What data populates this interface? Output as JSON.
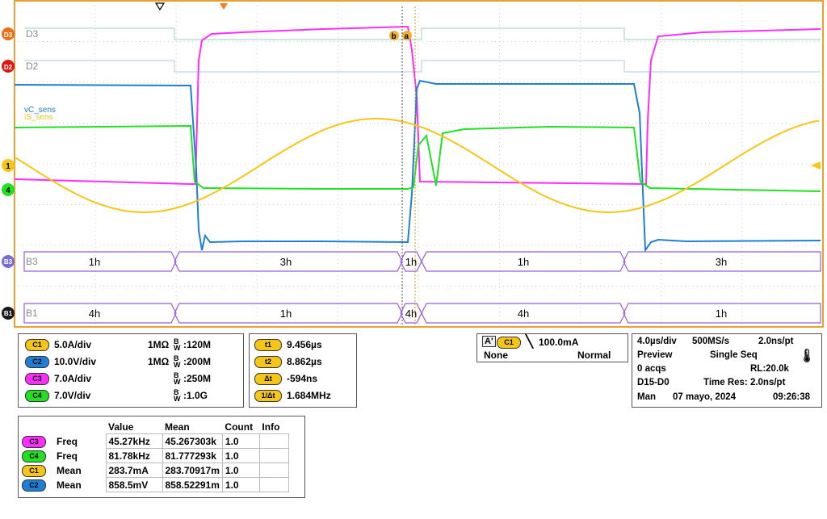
{
  "colors": {
    "c1": "#f5c518",
    "c2": "#1e7fd6",
    "c3": "#ff2cff",
    "c4": "#22e022",
    "d_trace": "#a8dcc8",
    "d_trace2": "#bcd4ec",
    "bus": "#9c5bd8",
    "graticule": "#e8a030"
  },
  "waveform": {
    "digital_labels": {
      "d3": "D3",
      "d2": "D2"
    },
    "channel_labels": {
      "vc": "vC_sens",
      "is": "iS_sens"
    },
    "cursor_labels": {
      "b": "b",
      "a": "a"
    },
    "bus_b3": {
      "label": "B3",
      "segments": [
        "1h",
        "3h",
        "1h",
        "1h",
        "3h"
      ]
    },
    "bus_b1": {
      "label": "B1",
      "segments": [
        "4h",
        "1h",
        "4h",
        "4h",
        "1h"
      ]
    },
    "left_markers": [
      "D3",
      "D2",
      "1",
      "4",
      "B3",
      "B1"
    ]
  },
  "channels": [
    {
      "id": "C1",
      "scale": "5.0A/div",
      "imp": "1MΩ",
      "bw": "120M",
      "color": "#f5c518"
    },
    {
      "id": "C2",
      "scale": "10.0V/div",
      "imp": "1MΩ",
      "bw": "200M",
      "color": "#1e7fd6"
    },
    {
      "id": "C3",
      "scale": "7.0A/div",
      "imp": "",
      "bw": "250M",
      "color": "#ff2cff"
    },
    {
      "id": "C4",
      "scale": "7.0V/div",
      "imp": "",
      "bw": "1.0G",
      "color": "#22e022"
    }
  ],
  "cursors": [
    {
      "label": "t1",
      "value": "9.456µs"
    },
    {
      "label": "t2",
      "value": "8.862µs"
    },
    {
      "label": "Δt",
      "value": "-594ns"
    },
    {
      "label": "1/Δt",
      "value": "1.684MHz"
    }
  ],
  "trigger": {
    "source": "A'",
    "channel": "C1",
    "level": "100.0mA",
    "coupling": "None",
    "mode": "Normal"
  },
  "acquisition": {
    "timebase": "4.0µs/div",
    "rate": "500MS/s",
    "res": "2.0ns/pt",
    "state": "Preview",
    "mode": "Single Seq",
    "acqs": "0 acqs",
    "rl": "RL:20.0k",
    "digital": "D15-D0",
    "time_res": "Time Res: 2.0ns/pt",
    "man": "Man",
    "date": "07 mayo, 2024",
    "time": "09:26:38"
  },
  "measurements": {
    "headers": [
      "Value",
      "Mean",
      "Count",
      "Info"
    ],
    "rows": [
      {
        "ch": "C3",
        "color": "#ff2cff",
        "name": "Freq",
        "value": "45.27kHz",
        "mean": "45.267303k",
        "count": "1.0"
      },
      {
        "ch": "C4",
        "color": "#22e022",
        "name": "Freq",
        "value": "81.78kHz",
        "mean": "81.777293k",
        "count": "1.0"
      },
      {
        "ch": "C1",
        "color": "#f5c518",
        "name": "Mean",
        "value": "283.7mA",
        "mean": "283.70917m",
        "count": "1.0"
      },
      {
        "ch": "C2",
        "color": "#1e7fd6",
        "name": "Mean",
        "value": "858.5mV",
        "mean": "858.52291m",
        "count": "1.0"
      }
    ]
  }
}
